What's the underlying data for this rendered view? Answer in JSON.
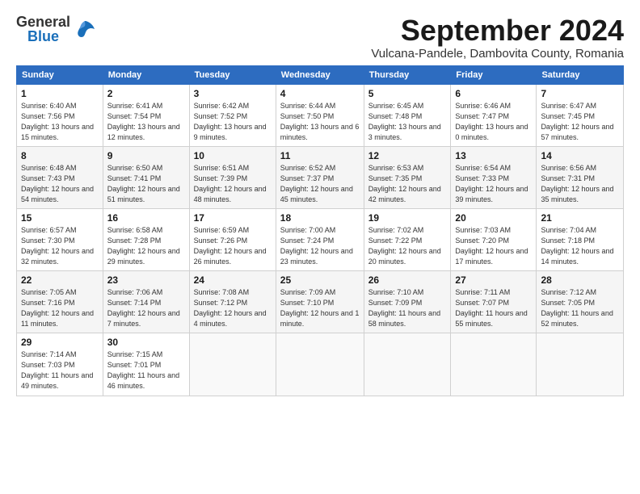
{
  "header": {
    "logo_general": "General",
    "logo_blue": "Blue",
    "month_title": "September 2024",
    "subtitle": "Vulcana-Pandele, Dambovita County, Romania"
  },
  "days_of_week": [
    "Sunday",
    "Monday",
    "Tuesday",
    "Wednesday",
    "Thursday",
    "Friday",
    "Saturday"
  ],
  "weeks": [
    [
      {
        "day": "1",
        "sunrise": "Sunrise: 6:40 AM",
        "sunset": "Sunset: 7:56 PM",
        "daylight": "Daylight: 13 hours and 15 minutes."
      },
      {
        "day": "2",
        "sunrise": "Sunrise: 6:41 AM",
        "sunset": "Sunset: 7:54 PM",
        "daylight": "Daylight: 13 hours and 12 minutes."
      },
      {
        "day": "3",
        "sunrise": "Sunrise: 6:42 AM",
        "sunset": "Sunset: 7:52 PM",
        "daylight": "Daylight: 13 hours and 9 minutes."
      },
      {
        "day": "4",
        "sunrise": "Sunrise: 6:44 AM",
        "sunset": "Sunset: 7:50 PM",
        "daylight": "Daylight: 13 hours and 6 minutes."
      },
      {
        "day": "5",
        "sunrise": "Sunrise: 6:45 AM",
        "sunset": "Sunset: 7:48 PM",
        "daylight": "Daylight: 13 hours and 3 minutes."
      },
      {
        "day": "6",
        "sunrise": "Sunrise: 6:46 AM",
        "sunset": "Sunset: 7:47 PM",
        "daylight": "Daylight: 13 hours and 0 minutes."
      },
      {
        "day": "7",
        "sunrise": "Sunrise: 6:47 AM",
        "sunset": "Sunset: 7:45 PM",
        "daylight": "Daylight: 12 hours and 57 minutes."
      }
    ],
    [
      {
        "day": "8",
        "sunrise": "Sunrise: 6:48 AM",
        "sunset": "Sunset: 7:43 PM",
        "daylight": "Daylight: 12 hours and 54 minutes."
      },
      {
        "day": "9",
        "sunrise": "Sunrise: 6:50 AM",
        "sunset": "Sunset: 7:41 PM",
        "daylight": "Daylight: 12 hours and 51 minutes."
      },
      {
        "day": "10",
        "sunrise": "Sunrise: 6:51 AM",
        "sunset": "Sunset: 7:39 PM",
        "daylight": "Daylight: 12 hours and 48 minutes."
      },
      {
        "day": "11",
        "sunrise": "Sunrise: 6:52 AM",
        "sunset": "Sunset: 7:37 PM",
        "daylight": "Daylight: 12 hours and 45 minutes."
      },
      {
        "day": "12",
        "sunrise": "Sunrise: 6:53 AM",
        "sunset": "Sunset: 7:35 PM",
        "daylight": "Daylight: 12 hours and 42 minutes."
      },
      {
        "day": "13",
        "sunrise": "Sunrise: 6:54 AM",
        "sunset": "Sunset: 7:33 PM",
        "daylight": "Daylight: 12 hours and 39 minutes."
      },
      {
        "day": "14",
        "sunrise": "Sunrise: 6:56 AM",
        "sunset": "Sunset: 7:31 PM",
        "daylight": "Daylight: 12 hours and 35 minutes."
      }
    ],
    [
      {
        "day": "15",
        "sunrise": "Sunrise: 6:57 AM",
        "sunset": "Sunset: 7:30 PM",
        "daylight": "Daylight: 12 hours and 32 minutes."
      },
      {
        "day": "16",
        "sunrise": "Sunrise: 6:58 AM",
        "sunset": "Sunset: 7:28 PM",
        "daylight": "Daylight: 12 hours and 29 minutes."
      },
      {
        "day": "17",
        "sunrise": "Sunrise: 6:59 AM",
        "sunset": "Sunset: 7:26 PM",
        "daylight": "Daylight: 12 hours and 26 minutes."
      },
      {
        "day": "18",
        "sunrise": "Sunrise: 7:00 AM",
        "sunset": "Sunset: 7:24 PM",
        "daylight": "Daylight: 12 hours and 23 minutes."
      },
      {
        "day": "19",
        "sunrise": "Sunrise: 7:02 AM",
        "sunset": "Sunset: 7:22 PM",
        "daylight": "Daylight: 12 hours and 20 minutes."
      },
      {
        "day": "20",
        "sunrise": "Sunrise: 7:03 AM",
        "sunset": "Sunset: 7:20 PM",
        "daylight": "Daylight: 12 hours and 17 minutes."
      },
      {
        "day": "21",
        "sunrise": "Sunrise: 7:04 AM",
        "sunset": "Sunset: 7:18 PM",
        "daylight": "Daylight: 12 hours and 14 minutes."
      }
    ],
    [
      {
        "day": "22",
        "sunrise": "Sunrise: 7:05 AM",
        "sunset": "Sunset: 7:16 PM",
        "daylight": "Daylight: 12 hours and 11 minutes."
      },
      {
        "day": "23",
        "sunrise": "Sunrise: 7:06 AM",
        "sunset": "Sunset: 7:14 PM",
        "daylight": "Daylight: 12 hours and 7 minutes."
      },
      {
        "day": "24",
        "sunrise": "Sunrise: 7:08 AM",
        "sunset": "Sunset: 7:12 PM",
        "daylight": "Daylight: 12 hours and 4 minutes."
      },
      {
        "day": "25",
        "sunrise": "Sunrise: 7:09 AM",
        "sunset": "Sunset: 7:10 PM",
        "daylight": "Daylight: 12 hours and 1 minute."
      },
      {
        "day": "26",
        "sunrise": "Sunrise: 7:10 AM",
        "sunset": "Sunset: 7:09 PM",
        "daylight": "Daylight: 11 hours and 58 minutes."
      },
      {
        "day": "27",
        "sunrise": "Sunrise: 7:11 AM",
        "sunset": "Sunset: 7:07 PM",
        "daylight": "Daylight: 11 hours and 55 minutes."
      },
      {
        "day": "28",
        "sunrise": "Sunrise: 7:12 AM",
        "sunset": "Sunset: 7:05 PM",
        "daylight": "Daylight: 11 hours and 52 minutes."
      }
    ],
    [
      {
        "day": "29",
        "sunrise": "Sunrise: 7:14 AM",
        "sunset": "Sunset: 7:03 PM",
        "daylight": "Daylight: 11 hours and 49 minutes."
      },
      {
        "day": "30",
        "sunrise": "Sunrise: 7:15 AM",
        "sunset": "Sunset: 7:01 PM",
        "daylight": "Daylight: 11 hours and 46 minutes."
      },
      null,
      null,
      null,
      null,
      null
    ]
  ]
}
